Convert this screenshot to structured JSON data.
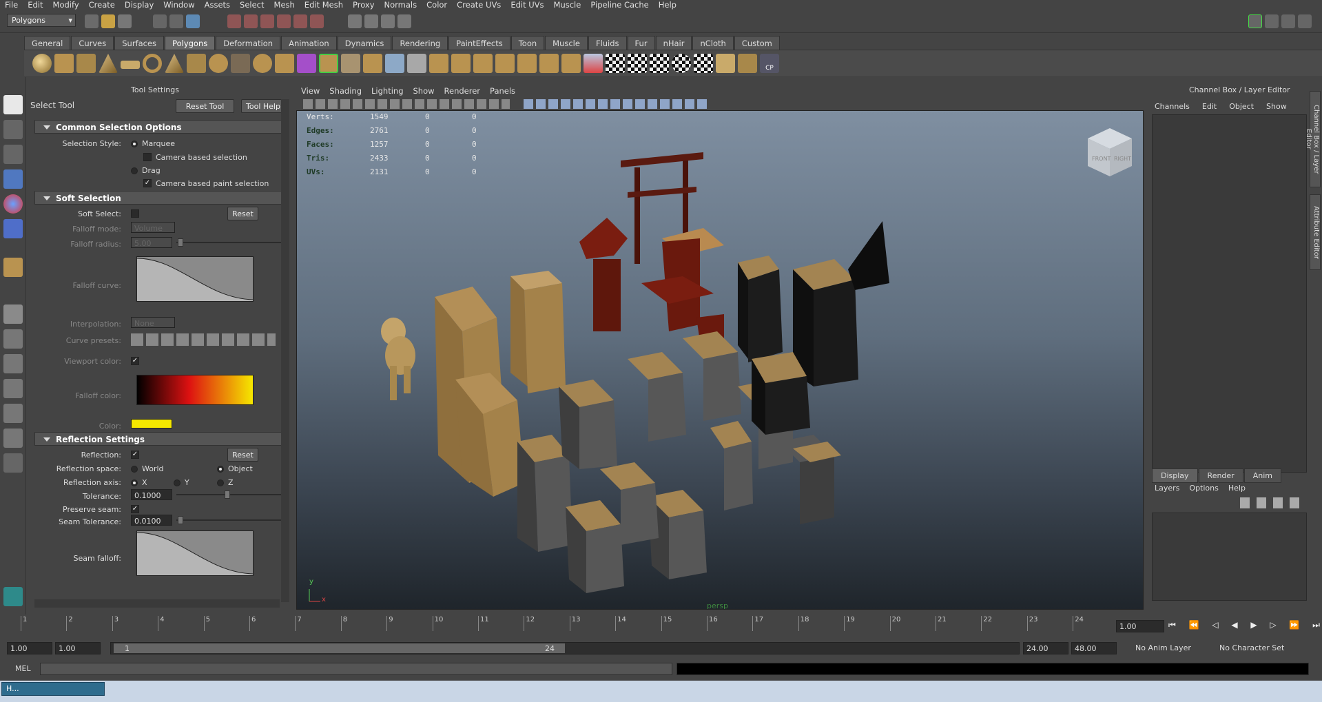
{
  "menubar": [
    "File",
    "Edit",
    "Modify",
    "Create",
    "Display",
    "Window",
    "Assets",
    "Select",
    "Mesh",
    "Edit Mesh",
    "Proxy",
    "Normals",
    "Color",
    "Create UVs",
    "Edit UVs",
    "Muscle",
    "Pipeline Cache",
    "Help"
  ],
  "status": {
    "mode": "Polygons"
  },
  "shelf_tabs": [
    "General",
    "Curves",
    "Surfaces",
    "Polygons",
    "Deformation",
    "Animation",
    "Dynamics",
    "Rendering",
    "PaintEffects",
    "Toon",
    "Muscle",
    "Fluids",
    "Fur",
    "nHair",
    "nCloth",
    "Custom"
  ],
  "shelf_active": "Polygons",
  "shelf_cp_label": "CP",
  "tool_settings": {
    "header": "Tool Settings",
    "tool_name": "Select Tool",
    "reset_tool": "Reset Tool",
    "tool_help": "Tool Help",
    "common": {
      "title": "Common Selection Options",
      "style_label": "Selection Style:",
      "marquee": "Marquee",
      "camera_based": "Camera based selection",
      "drag": "Drag",
      "camera_paint": "Camera based paint selection"
    },
    "soft": {
      "title": "Soft Selection",
      "soft_select": "Soft Select:",
      "reset": "Reset",
      "falloff_mode": "Falloff mode:",
      "falloff_mode_value": "Volume",
      "falloff_radius": "Falloff radius:",
      "falloff_radius_value": "5.00",
      "falloff_curve": "Falloff curve:",
      "interpolation": "Interpolation:",
      "interpolation_value": "None",
      "curve_presets": "Curve presets:",
      "viewport_color": "Viewport color:",
      "falloff_color": "Falloff color:",
      "color": "Color:",
      "color_value": "#f5e800"
    },
    "reflection": {
      "title": "Reflection Settings",
      "reflection": "Reflection:",
      "reset": "Reset",
      "space": "Reflection space:",
      "world": "World",
      "object": "Object",
      "axis": "Reflection axis:",
      "x": "X",
      "y": "Y",
      "z": "Z",
      "tolerance": "Tolerance:",
      "tolerance_value": "0.1000",
      "preserve_seam": "Preserve seam:",
      "seam_tolerance": "Seam Tolerance:",
      "seam_tolerance_value": "0.0100",
      "seam_falloff": "Seam falloff:"
    }
  },
  "viewport": {
    "menu": [
      "View",
      "Shading",
      "Lighting",
      "Show",
      "Renderer",
      "Panels"
    ],
    "hud": [
      {
        "label": "Verts:",
        "a": "1549",
        "b": "0",
        "c": "0"
      },
      {
        "label": "Edges:",
        "a": "2761",
        "b": "0",
        "c": "0"
      },
      {
        "label": "Faces:",
        "a": "1257",
        "b": "0",
        "c": "0"
      },
      {
        "label": "Tris:",
        "a": "2433",
        "b": "0",
        "c": "0"
      },
      {
        "label": "UVs:",
        "a": "2131",
        "b": "0",
        "c": "0"
      }
    ],
    "camera": "persp",
    "viewcube_front": "FRONT",
    "viewcube_right": "RIGHT",
    "axis_y": "y",
    "axis_x": "x"
  },
  "channel_box": {
    "title": "Channel Box / Layer Editor",
    "menu": [
      "Channels",
      "Edit",
      "Object",
      "Show"
    ],
    "layer_tabs": [
      "Display",
      "Render",
      "Anim"
    ],
    "layer_menu": [
      "Layers",
      "Options",
      "Help"
    ]
  },
  "side_tabs": [
    "Channel Box / Layer Editor",
    "Attribute Editor"
  ],
  "timeline": {
    "ticks": [
      "1",
      "2",
      "3",
      "4",
      "5",
      "6",
      "7",
      "8",
      "9",
      "10",
      "11",
      "12",
      "13",
      "14",
      "15",
      "16",
      "17",
      "18",
      "19",
      "20",
      "21",
      "22",
      "23",
      "24"
    ],
    "current": "1.00"
  },
  "range": {
    "start": "1.00",
    "start2": "1.00",
    "slider_start": "1",
    "slider_end": "24",
    "end": "24.00",
    "end2": "48.00",
    "anim_layer": "No Anim Layer",
    "char_set": "No Character Set"
  },
  "cmd": {
    "label": "MEL"
  },
  "taskbar": {
    "item": "H..."
  }
}
